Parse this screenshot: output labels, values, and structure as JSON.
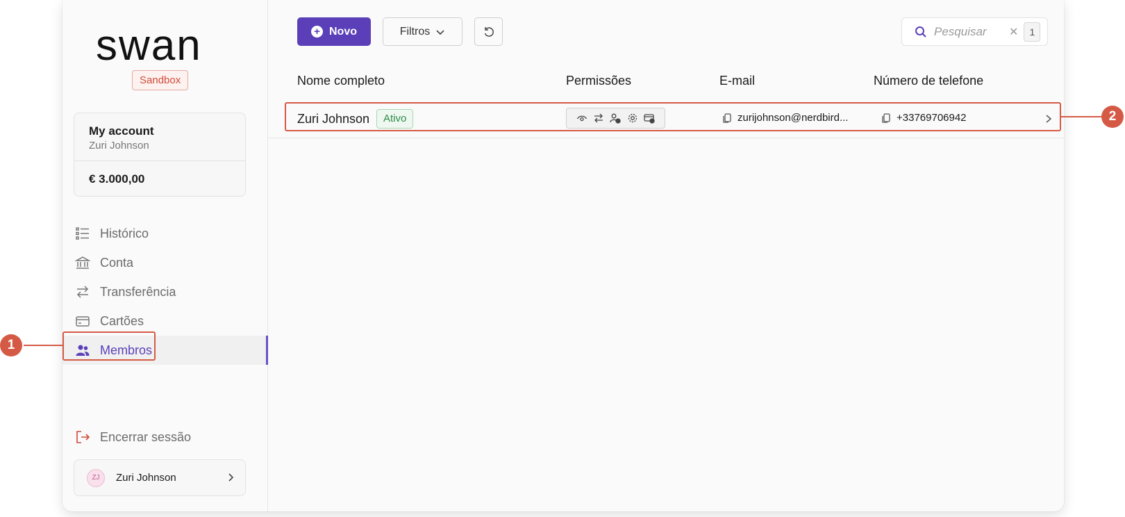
{
  "app": {
    "logo_text": "swan",
    "environment": "Sandbox"
  },
  "account": {
    "title": "My account",
    "holder": "Zuri Johnson",
    "balance": "€ 3.000,00"
  },
  "nav": {
    "items": [
      {
        "label": "Histórico",
        "icon": "list-icon"
      },
      {
        "label": "Conta",
        "icon": "bank-icon"
      },
      {
        "label": "Transferência",
        "icon": "transfer-icon"
      },
      {
        "label": "Cartões",
        "icon": "card-icon"
      },
      {
        "label": "Membros",
        "icon": "members-icon",
        "active": true
      }
    ],
    "logout": "Encerrar sessão"
  },
  "user": {
    "initials": "ZJ",
    "name": "Zuri Johnson"
  },
  "toolbar": {
    "new_label": "Novo",
    "filters_label": "Filtros",
    "search_placeholder": "Pesquisar",
    "search_count": "1"
  },
  "table": {
    "headers": [
      "Nome completo",
      "Permissões",
      "E-mail",
      "Número de telefone"
    ],
    "rows": [
      {
        "name": "Zuri Johnson",
        "status": "Ativo",
        "permissions": [
          "eye-icon",
          "transfer-icon",
          "user-add-icon",
          "gear-icon",
          "card-add-icon"
        ],
        "email": "zurijohnson@nerdbird...",
        "phone": "+33769706942"
      }
    ]
  },
  "annotations": [
    "1",
    "2"
  ],
  "colors": {
    "accent": "#5a3fb8",
    "highlight": "#d45a45",
    "status_active": "#2d8a4a"
  }
}
